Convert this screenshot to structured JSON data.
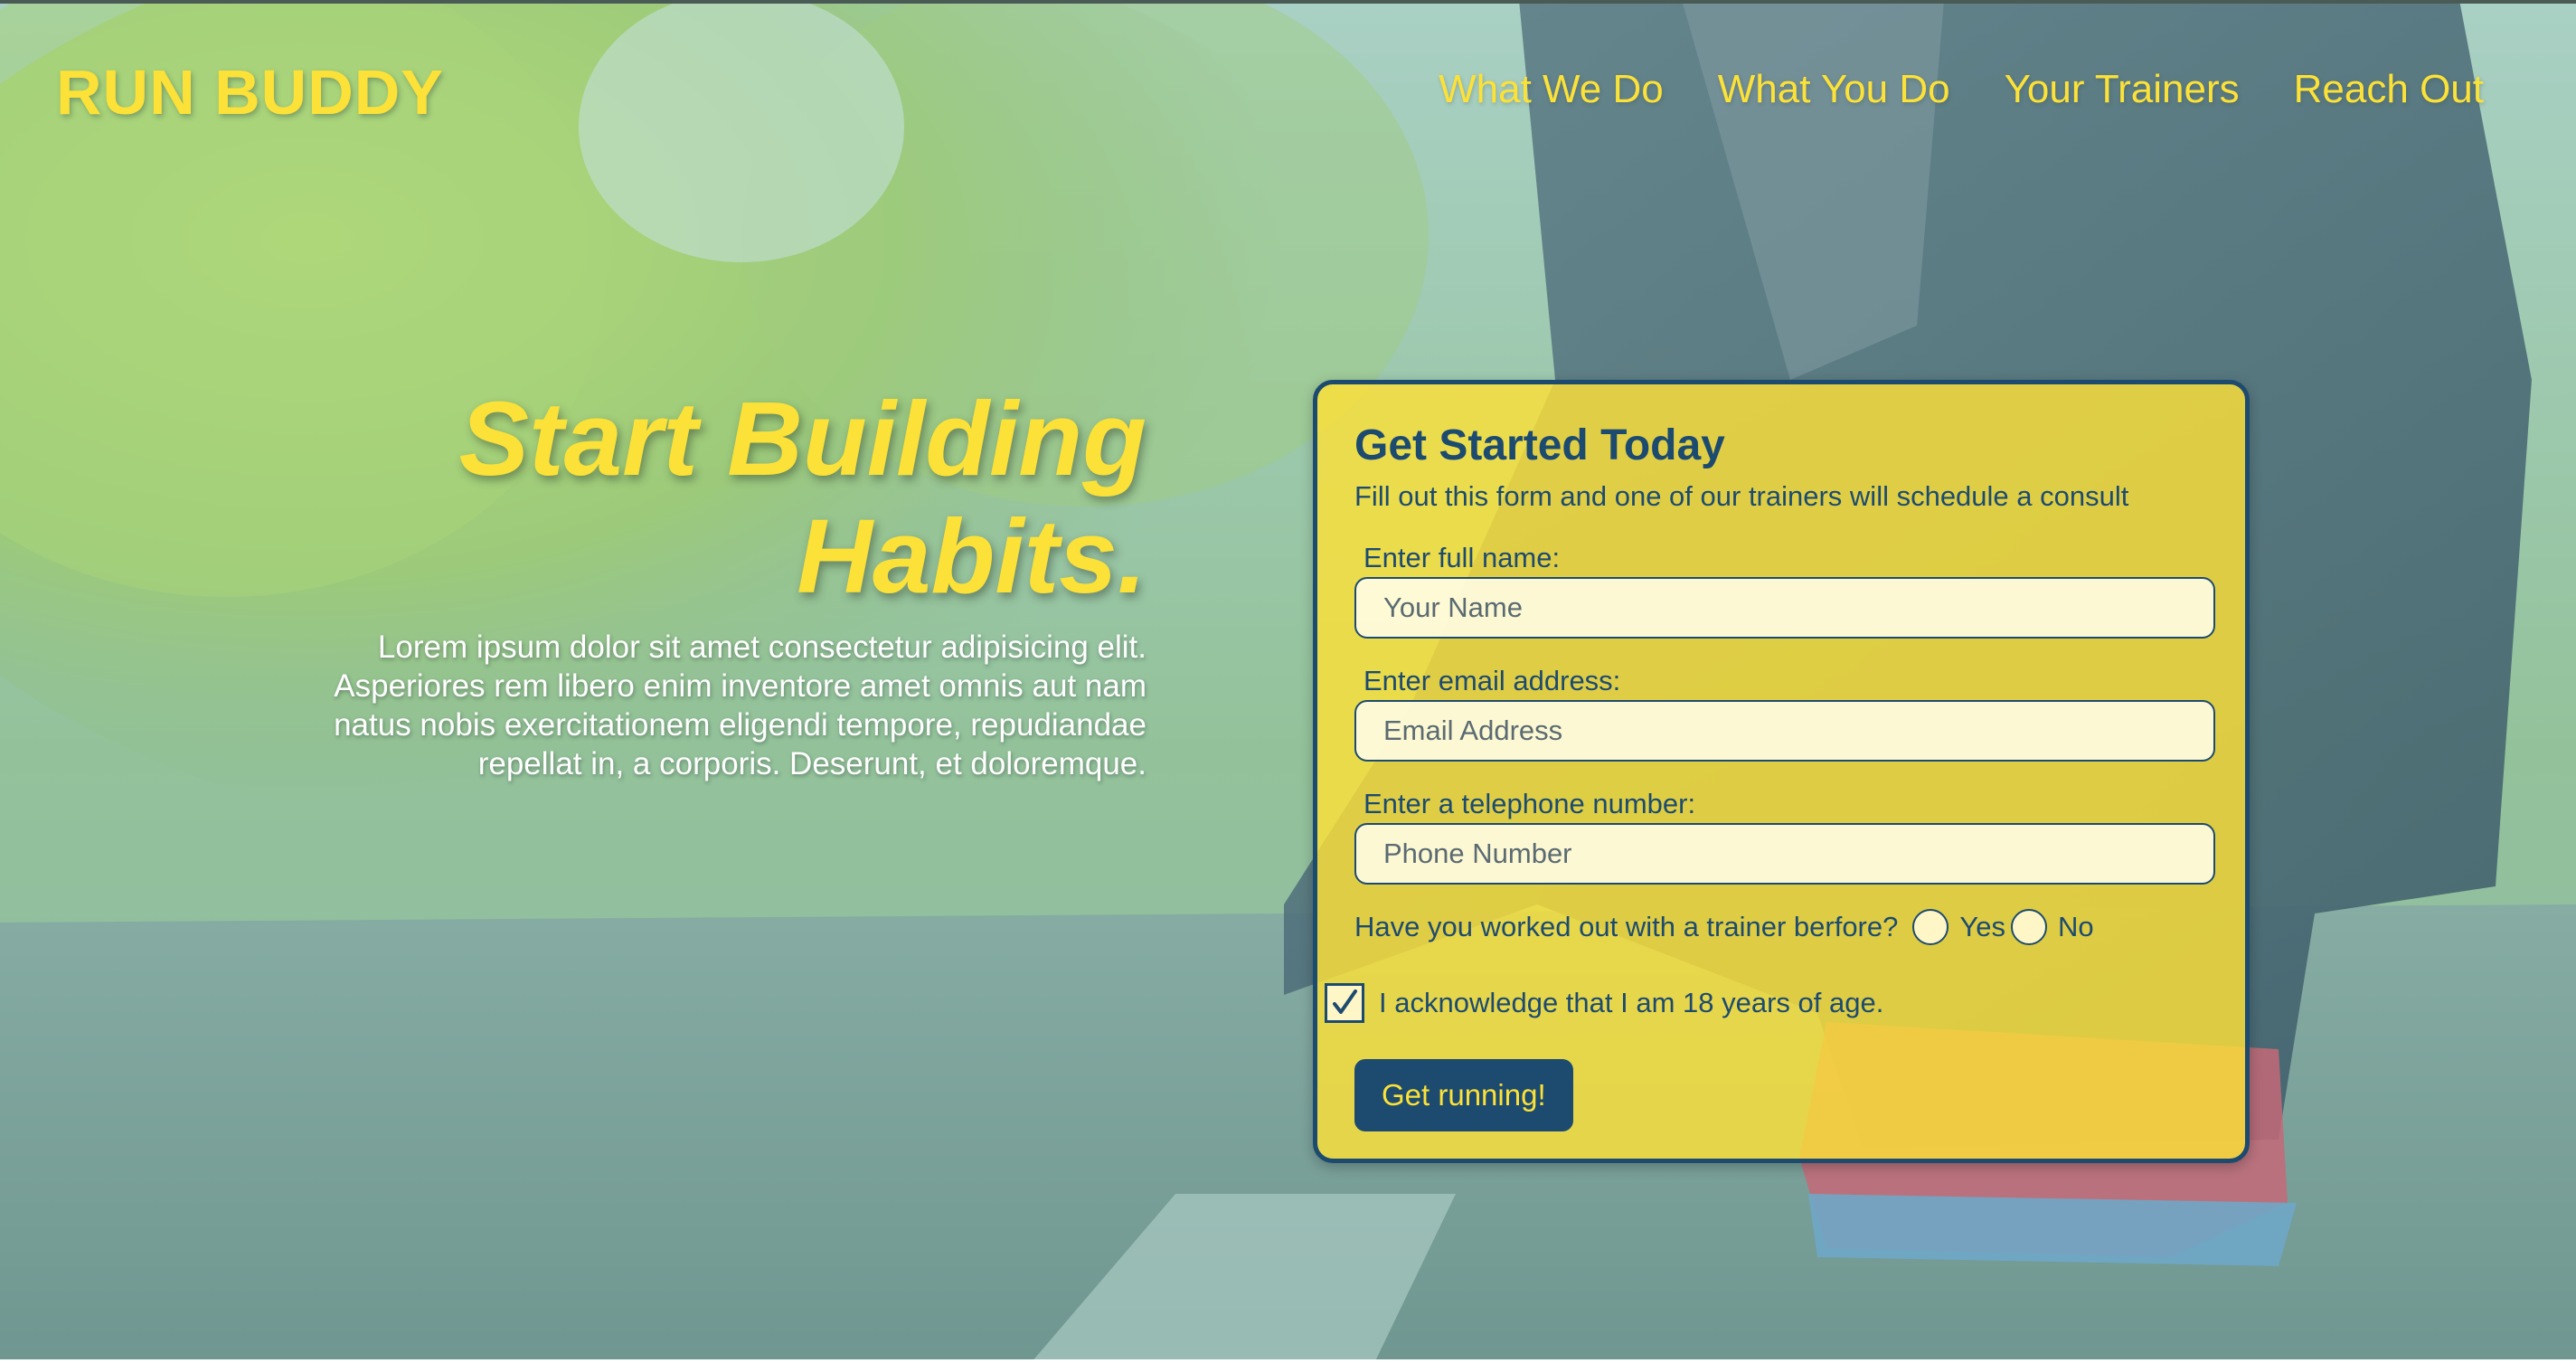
{
  "header": {
    "logo": "RUN BUDDY",
    "nav": [
      "What We Do",
      "What You Do",
      "Your Trainers",
      "Reach Out"
    ]
  },
  "hero": {
    "title_line1": "Start Building",
    "title_line2": "Habits.",
    "body": "Lorem ipsum dolor sit amet consectetur adipisicing elit. Asperiores rem libero enim inventore amet omnis aut nam natus nobis exercitationem eligendi tempore, repudiandae repellat in, a corporis. Deserunt, et doloremque."
  },
  "form": {
    "title": "Get Started Today",
    "subtitle": "Fill out this form and one of our trainers will schedule a consult",
    "name_label": "Enter full name:",
    "name_placeholder": "Your Name",
    "email_label": "Enter email address:",
    "email_placeholder": "Email Address",
    "phone_label": "Enter a telephone number:",
    "phone_placeholder": "Phone Number",
    "trainer_question": "Have you worked out with a trainer berfore?",
    "yes_label": "Yes",
    "no_label": "No",
    "acknowledge_label": "I acknowledge that I am 18 years of age.",
    "acknowledge_checked": true,
    "submit_label": "Get running!"
  },
  "colors": {
    "accent_yellow": "#fce138",
    "primary_blue": "#1d4b6f",
    "overlay_teal": "#8db8a0"
  },
  "icons": {
    "checkbox_mark": "checkmark-icon"
  }
}
